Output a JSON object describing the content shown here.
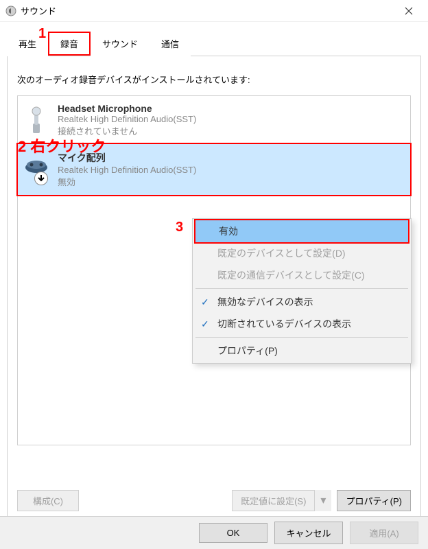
{
  "window": {
    "title": "サウンド"
  },
  "tabs": {
    "playback": "再生",
    "recording": "録音",
    "sound": "サウンド",
    "communication": "通信",
    "active": "recording"
  },
  "instruction": "次のオーディオ録音デバイスがインストールされています:",
  "devices": [
    {
      "name": "Headset Microphone",
      "sub": "Realtek High Definition Audio(SST)",
      "status": "接続されていません"
    },
    {
      "name": "マイク配列",
      "sub": "Realtek High Definition Audio(SST)",
      "status": "無効"
    }
  ],
  "contextMenu": {
    "enable": "有効",
    "setDefault": "既定のデバイスとして設定(D)",
    "setDefaultComm": "既定の通信デバイスとして設定(C)",
    "showDisabled": "無効なデバイスの表示",
    "showDisconnected": "切断されているデバイスの表示",
    "properties": "プロパティ(P)"
  },
  "panelButtons": {
    "configure": "構成(C)",
    "setDefaultBtn": "既定値に設定(S)",
    "propertiesBtn": "プロパティ(P)"
  },
  "dialogButtons": {
    "ok": "OK",
    "cancel": "キャンセル",
    "apply": "適用(A)"
  },
  "annotations": {
    "a1": "1",
    "a2": "2 右クリック",
    "a3": "3"
  }
}
